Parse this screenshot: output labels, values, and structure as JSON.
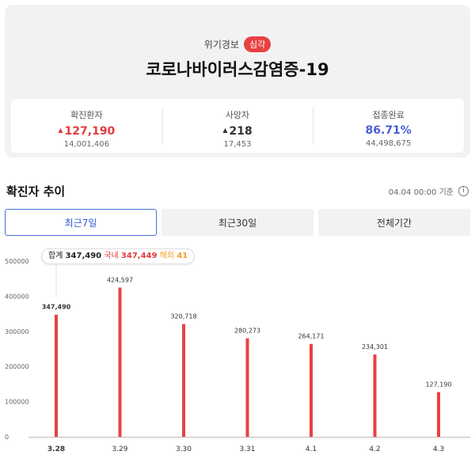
{
  "alert": {
    "label": "위기경보",
    "level": "심각"
  },
  "title": "코로나바이러스감염증-19",
  "stats": [
    {
      "name": "확진환자",
      "arrow": "▲",
      "value": "127,190",
      "sub": "14,001,406",
      "color": "red"
    },
    {
      "name": "사망자",
      "arrow": "▲",
      "value": "218",
      "sub": "17,453",
      "color": "dark"
    },
    {
      "name": "접종완료",
      "arrow": "",
      "value": "86.71%",
      "sub": "44,498,675",
      "color": "blue"
    }
  ],
  "section": {
    "title": "확진자 추이",
    "date": "04.04 00:00 기준",
    "info_icon": "info-icon"
  },
  "tabs": [
    {
      "label": "최근7일",
      "active": true
    },
    {
      "label": "최근30일",
      "active": false
    },
    {
      "label": "전체기간",
      "active": false
    }
  ],
  "tooltip": {
    "total_label": "합계",
    "total": "347,490",
    "domestic_label": "국내",
    "domestic": "347,449",
    "overseas_label": "해외",
    "overseas": "41"
  },
  "colors": {
    "bar": "#e84142",
    "accent": "#4a72d8",
    "blue": "#4a5fd8"
  },
  "chart_data": {
    "type": "bar",
    "categories": [
      "3.28",
      "3.29",
      "3.30",
      "3.31",
      "4.1",
      "4.2",
      "4.3"
    ],
    "values": [
      347490,
      424597,
      320718,
      280273,
      264171,
      234301,
      127190
    ],
    "value_labels": [
      "347,490",
      "424,597",
      "320,718",
      "280,273",
      "264,171",
      "234,301",
      "127,190"
    ],
    "yticks": [
      "0",
      "100000",
      "200000",
      "300000",
      "400000",
      "500000"
    ],
    "ylim": [
      0,
      500000
    ],
    "highlighted_index": 0
  }
}
